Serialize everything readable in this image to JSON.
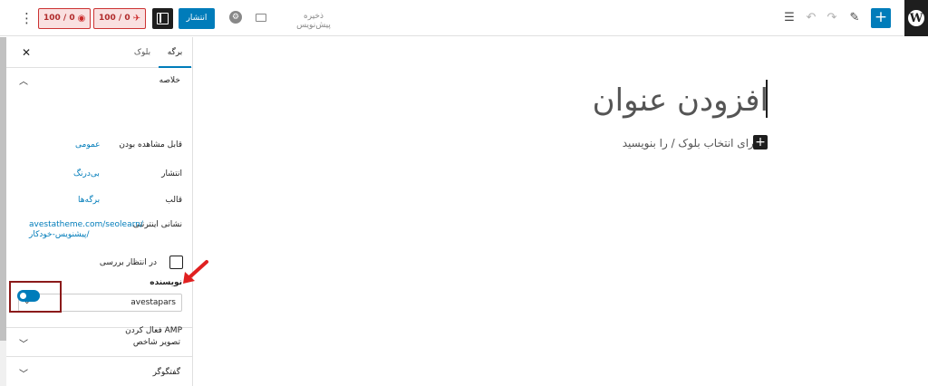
{
  "header": {
    "save_draft": "ذخیره پیش‌نویس",
    "publish": "انتشار",
    "badge_readability": "100 / 0",
    "badge_seo": "100 / 0",
    "add_icon": "+",
    "list_view_icon": "☰",
    "undo_icon": "↶",
    "redo_icon": "↷",
    "tools_icon": "✎",
    "more_icon": "⋮",
    "wp_logo": "W"
  },
  "editor": {
    "title_placeholder": "افزودن عنوان",
    "block_placeholder": "برای انتخاب بلوک / را بنویسید",
    "inserter_icon": "+"
  },
  "sidebar": {
    "tabs": [
      "برگه",
      "بلوک"
    ],
    "close_icon": "✕",
    "summary": {
      "title": "خلاصه",
      "rows": [
        {
          "key": "قابل مشاهده بودن",
          "value": "عمومی"
        },
        {
          "key": "انتشار",
          "value": "بی‌درنگ"
        },
        {
          "key": "قالب",
          "value": "برگه‌ها"
        },
        {
          "key": "نشانی اینترنتی",
          "value": "avestatheme.com/seolearn/پیشنویس-خودکار/"
        }
      ],
      "pending_review": "در انتظار بررسی",
      "author_label": "نویسنده",
      "author_value": "avestapars",
      "amp_label": "فعال کردن AMP",
      "amp_enabled": true
    },
    "panels": [
      "تصویر شاخص",
      "گفتگوگر"
    ]
  },
  "colors": {
    "accent": "#007cba",
    "badge_border": "#cc3333",
    "highlight": "#8b1a1a",
    "arrow": "#e02020"
  }
}
